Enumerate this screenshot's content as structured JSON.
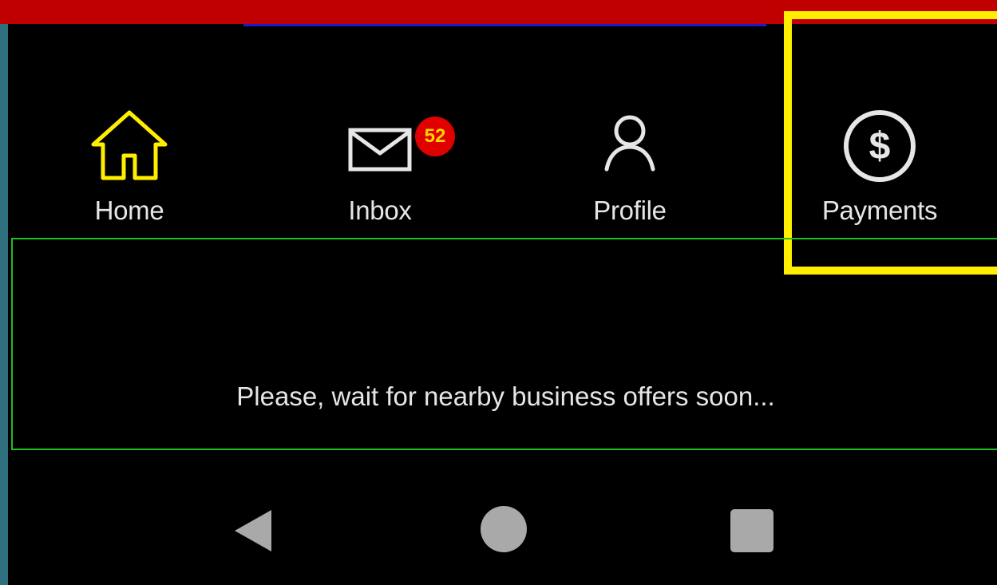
{
  "colors": {
    "top_bar": "#c00000",
    "left_edge": "#2f6f80",
    "active_icon": "#ffee00",
    "inactive_icon": "#e6e6e6",
    "badge_bg": "#e00000",
    "badge_text": "#ffd400",
    "content_border": "#1fbd1f",
    "highlight_box": "#ffee00",
    "system_buttons": "#a9a9a9"
  },
  "bottom_nav": {
    "items": [
      {
        "label": "Home",
        "icon": "home-icon",
        "active": true
      },
      {
        "label": "Inbox",
        "icon": "mail-icon",
        "badge": "52"
      },
      {
        "label": "Profile",
        "icon": "user-icon"
      },
      {
        "label": "Payments",
        "icon": "dollar-circle-icon",
        "highlighted": true
      }
    ]
  },
  "content": {
    "message": "Please, wait for nearby business offers soon..."
  },
  "system_nav": {
    "buttons": [
      "back-icon",
      "home-circle-icon",
      "recents-square-icon"
    ]
  }
}
